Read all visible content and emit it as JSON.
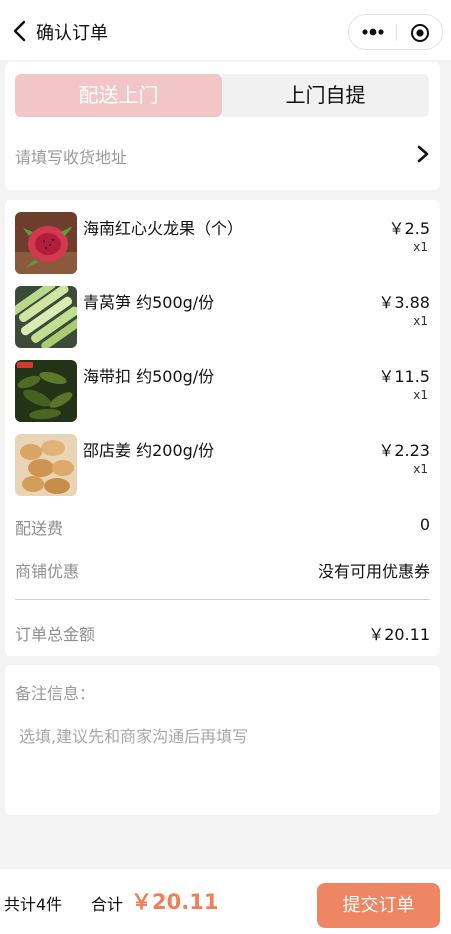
{
  "nav": {
    "title": "确认订单"
  },
  "delivery": {
    "tab_delivery": "配送上门",
    "tab_pickup": "上门自提",
    "address_placeholder": "请填写收货地址"
  },
  "items": [
    {
      "name": "海南红心火龙果（个）",
      "price": "￥2.5",
      "qty": "x1",
      "image": "dragon-fruit"
    },
    {
      "name": "青莴笋 约500g/份",
      "price": "￥3.88",
      "qty": "x1",
      "image": "celtuce"
    },
    {
      "name": "海带扣 约500g/份",
      "price": "￥11.5",
      "qty": "x1",
      "image": "kelp-knots"
    },
    {
      "name": "邵店姜 约200g/份",
      "price": "￥2.23",
      "qty": "x1",
      "image": "ginger"
    }
  ],
  "fees": {
    "delivery_label": "配送费",
    "delivery_value": "0",
    "discount_label": "商铺优惠",
    "discount_value": "没有可用优惠券",
    "total_label": "订单总金额",
    "total_value": "￥20.11"
  },
  "remark": {
    "label": "备注信息：",
    "placeholder": "选填,建议先和商家沟通后再填写"
  },
  "footer": {
    "count": "共计4件",
    "total_label": "合计",
    "total_amount": "￥20.11",
    "submit_label": "提交订单"
  },
  "colors": {
    "accent": "#ef8562",
    "price_accent": "#ef7f56",
    "tab_active": "#f2c6c6"
  }
}
